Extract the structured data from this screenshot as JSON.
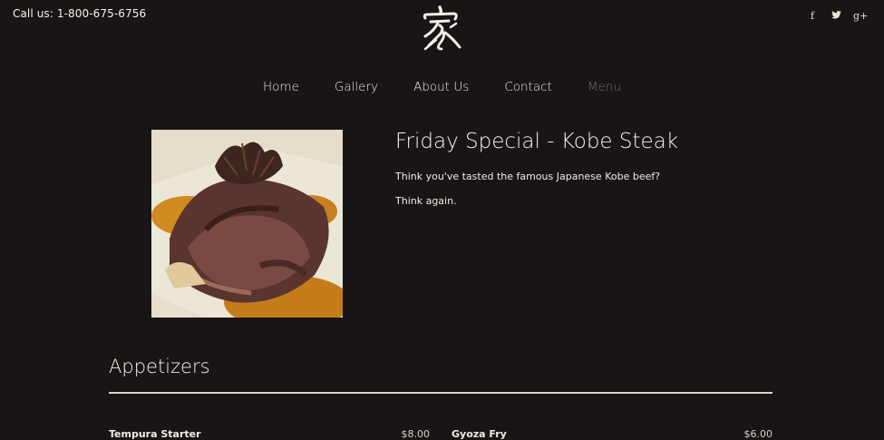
{
  "header": {
    "phone": "Call us: 1-800-675-6756",
    "logo_icon": "kanji-logo-icon",
    "social": [
      {
        "label": "f",
        "icon": "facebook-icon"
      },
      {
        "label": "t",
        "icon": "twitter-icon"
      },
      {
        "label": "g+",
        "icon": "google-plus-icon"
      }
    ]
  },
  "nav": {
    "items": [
      "Home",
      "Gallery",
      "About Us",
      "Contact",
      "Menu"
    ],
    "active": "Menu"
  },
  "special": {
    "title": "Friday Special - Kobe Steak",
    "paragraph1": "Think you've tasted the famous Japanese Kobe beef?",
    "paragraph2": "Think again."
  },
  "section": {
    "title": "Appetizers",
    "items": [
      {
        "name": "Tempura Starter",
        "price": "$8.00"
      },
      {
        "name": "Gyoza Fry",
        "price": "$6.00"
      }
    ]
  },
  "colors": {
    "background": "#191516",
    "active_nav": "#7e6a5e"
  }
}
